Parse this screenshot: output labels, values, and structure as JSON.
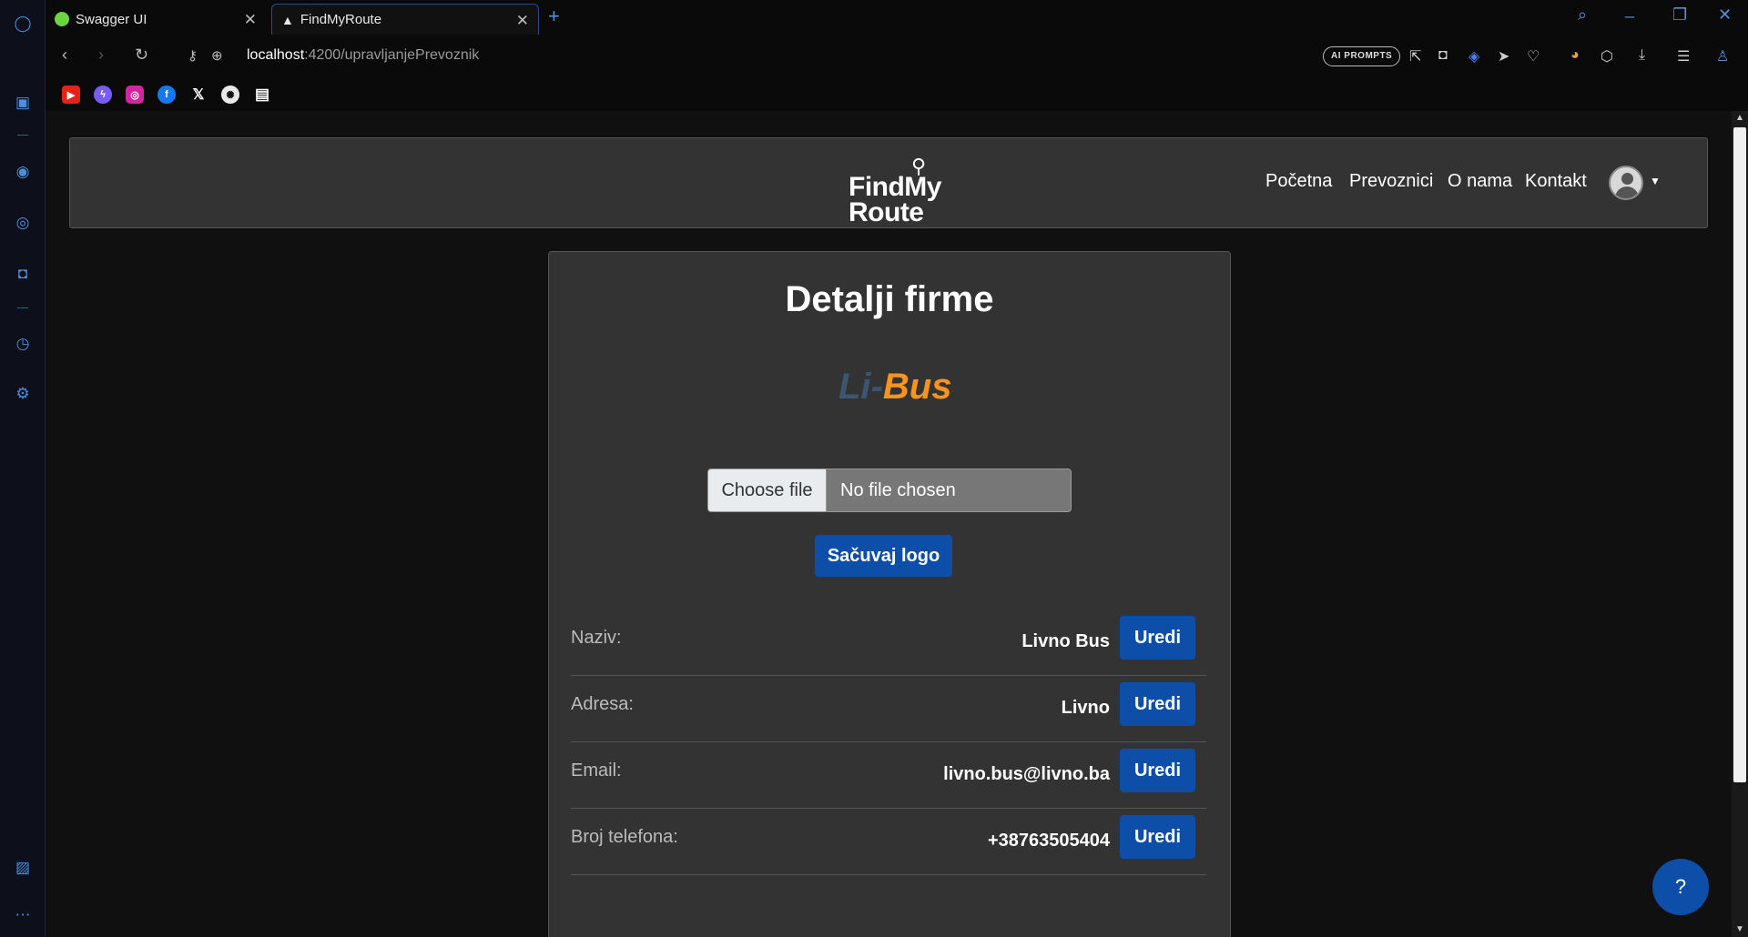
{
  "browser": {
    "tabs": [
      {
        "title": "Swagger UI",
        "favicon_color": "#6bd43f"
      },
      {
        "title": "FindMyRoute",
        "favicon_color": "#ffffff"
      }
    ],
    "url_host": "localhost",
    "url_path": ":4200/upravljanjePrevoznik",
    "ai_prompts_label": "AI PROMPTS",
    "bookmarks": [
      "youtube",
      "messenger",
      "instagram",
      "facebook",
      "x",
      "chatgpt",
      "document"
    ]
  },
  "navbar": {
    "brand_line1": "FindMy",
    "brand_line2": "Route",
    "links": [
      "Početna",
      "Prevoznici",
      "O nama",
      "Kontakt"
    ]
  },
  "card": {
    "title": "Detalji firme",
    "logo_part1": "Li-",
    "logo_part2": "Bus",
    "file_button": "Choose file",
    "file_status": "No file chosen",
    "save_logo_label": "Sačuvaj logo",
    "edit_label": "Uredi",
    "fields": [
      {
        "label": "Naziv:",
        "value": "Livno Bus"
      },
      {
        "label": "Adresa:",
        "value": "Livno"
      },
      {
        "label": "Email:",
        "value": "livno.bus@livno.ba"
      },
      {
        "label": "Broj telefona:",
        "value": "+38763505404"
      }
    ]
  },
  "help_label": "?",
  "colors": {
    "accent": "#0d4fa8",
    "card_bg": "#333333",
    "page_bg": "#101010",
    "logo_orange": "#f7941d"
  }
}
